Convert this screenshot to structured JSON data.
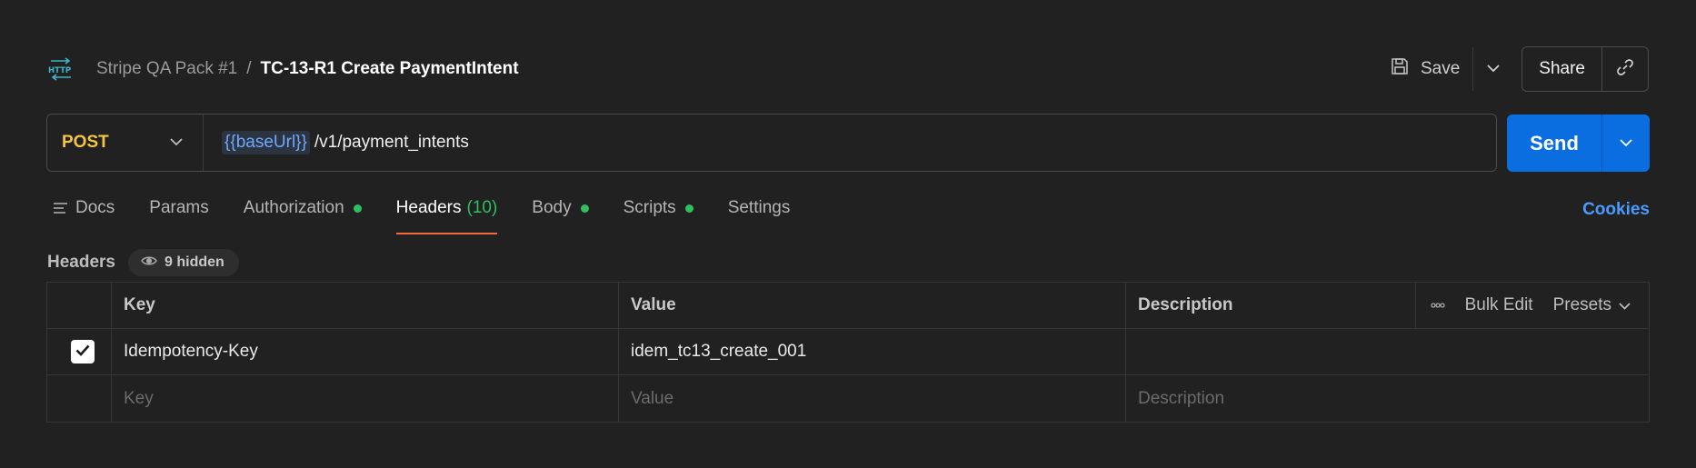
{
  "breadcrumb": {
    "icon": "http-icon",
    "parent": "Stripe QA Pack #1",
    "separator": "/",
    "current": "TC-13-R1 Create PaymentIntent"
  },
  "actions": {
    "save_label": "Save",
    "share_label": "Share"
  },
  "request": {
    "method": "POST",
    "url_variable": "{{baseUrl}}",
    "url_path": "/v1/payment_intents",
    "send_label": "Send"
  },
  "tabs": [
    {
      "label": "Docs"
    },
    {
      "label": "Params"
    },
    {
      "label": "Authorization",
      "dot": true
    },
    {
      "label": "Headers",
      "count": "(10)",
      "active": true
    },
    {
      "label": "Body",
      "dot": true
    },
    {
      "label": "Scripts",
      "dot": true
    },
    {
      "label": "Settings"
    }
  ],
  "cookies_label": "Cookies",
  "headers_section": {
    "title": "Headers",
    "hidden_label": "9 hidden"
  },
  "table": {
    "columns": {
      "key": "Key",
      "value": "Value",
      "description": "Description"
    },
    "bulk_edit_label": "Bulk Edit",
    "presets_label": "Presets",
    "rows": [
      {
        "checked": true,
        "key": "Idempotency-Key",
        "value": "idem_tc13_create_001",
        "description": ""
      }
    ],
    "placeholders": {
      "key": "Key",
      "value": "Value",
      "description": "Description"
    }
  },
  "colors": {
    "background": "#212121",
    "method": "#f5c542",
    "send": "#0a6de0",
    "active_tab_underline": "#f26b3a",
    "status_dot": "#2fbf5f",
    "link": "#4a9bff",
    "variable": "#6fa8ff"
  }
}
